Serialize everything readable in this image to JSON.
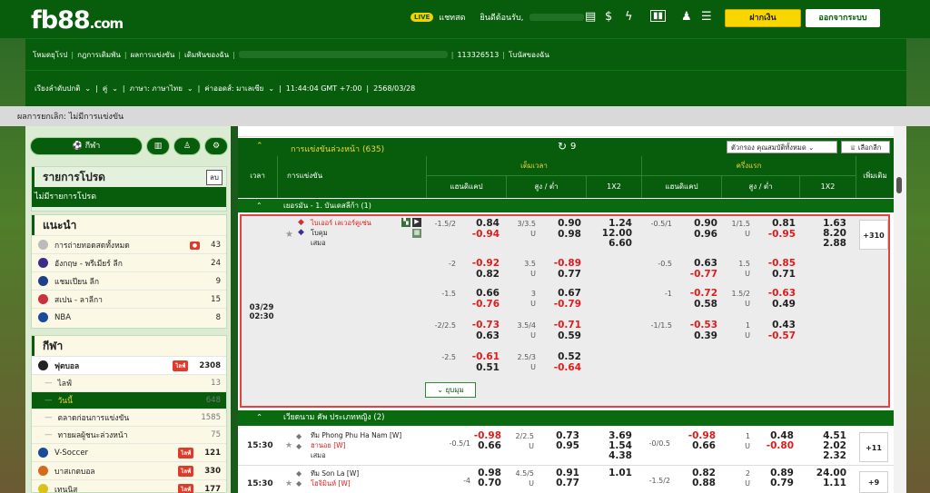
{
  "header": {
    "logo_main": "fb88",
    "logo_suffix": ".com",
    "chat_label": "แชทสด",
    "chat_badge": "LIVE",
    "welcome": "ยินดีต้อนรับ,",
    "deposit_label": "ฝากเงิน",
    "logout_label": "ออกจากระบบ"
  },
  "nav1": {
    "items": [
      "โหมดยุโรป",
      "กฎการเดิมพัน",
      "ผลการแข่งขัน",
      "เดิมพันของฉัน"
    ],
    "account_id": "113326513",
    "bonus_label": "โบนัสของฉัน"
  },
  "nav2": {
    "sort": "เรียงลำดับปกติ",
    "pair": "คู่",
    "lang": "ภาษา: ภาษาไทย",
    "odds": "ค่าออดส์: มาเลเซีย",
    "time": "11:44:04 GMT +7:00",
    "date": "2568/03/28"
  },
  "strip_text": "ผลการยกเลิก: ไม่มีการแข่งขัน",
  "left": {
    "sport_btn": "กีฬา",
    "fav_title": "รายการโปรด",
    "fav_toggle": "ลบ",
    "fav_empty": "ไม่มีรายการโปรด",
    "rec_title": "แนะนำ",
    "rec_items": [
      {
        "label": "การถ่ายทอดสดทั้งหมด",
        "count": "43",
        "live": true
      },
      {
        "label": "อังกฤษ - พรีเมียร์ ลีก",
        "count": "24"
      },
      {
        "label": "แชมเปียน ลีก",
        "count": "9"
      },
      {
        "label": "สเปน - ลาลีกา",
        "count": "15"
      },
      {
        "label": "NBA",
        "count": "8"
      }
    ],
    "sport_title": "กีฬา",
    "sport_items": [
      {
        "label": "ฟุตบอล",
        "count": "2308",
        "live": true,
        "sub": false
      },
      {
        "label": "ไลฟ์",
        "count": "13",
        "sub": true
      },
      {
        "label": "วันนี้",
        "count": "648",
        "sub": true,
        "active": true
      },
      {
        "label": "ตลาดก่อนการแข่งขัน",
        "count": "1585",
        "sub": true
      },
      {
        "label": "ทายผลผู้ชนะล่วงหน้า",
        "count": "75",
        "sub": true
      },
      {
        "label": "V-Soccer",
        "count": "121",
        "live": true
      },
      {
        "label": "บาสเกตบอล",
        "count": "330",
        "live": true
      },
      {
        "label": "เทนนิส",
        "count": "177",
        "live": true
      }
    ],
    "live_badge": "ไลฟ์"
  },
  "market": {
    "title": "การแข่งขันล่วงหน้า (635)",
    "refresh": "9",
    "filter": "ตัวกรอง คุณสมบัติทั้งหมด",
    "select": "เลือกลีก"
  },
  "cols": {
    "time": "เวลา",
    "match": "การแข่งขัน",
    "fulltime": "เต็มเวลา",
    "firsthalf": "ครึ่งแรก",
    "hdp": "แฮนดิแคป",
    "ou": "สูง / ต่ำ",
    "x12": "1X2",
    "more": "เพิ่มเติม"
  },
  "league1": "เยอรมัน - 1. บันเดสลีก้า (1)",
  "match1": {
    "date": "03/29",
    "time": "02:30",
    "home": "ไบเออร์ เลเวอร์คูเซ่น",
    "away": "โบคุม",
    "draw": "เสมอ",
    "more": "+310",
    "lines": [
      {
        "hdp": "-1.5/2",
        "h1": "0.84",
        "h2": "-0.94",
        "ou": "3/3.5",
        "o1": "0.90",
        "o2": "0.98",
        "x": [
          "1.24",
          "12.00",
          "6.60"
        ],
        "hhdp": "-0.5/1",
        "hh1": "0.90",
        "hh2": "0.96",
        "hou": "1/1.5",
        "ho1": "0.81",
        "ho2": "-0.95",
        "hx": [
          "1.63",
          "8.20",
          "2.88"
        ]
      },
      {
        "hdp": "-2",
        "h1": "-0.92",
        "h2": "0.82",
        "ou": "3.5",
        "o1": "-0.89",
        "o2": "0.77",
        "hhdp": "-0.5",
        "hh1": "0.63",
        "hh2": "-0.77",
        "hou": "1.5",
        "ho1": "-0.85",
        "ho2": "0.71"
      },
      {
        "hdp": "-1.5",
        "h1": "0.66",
        "h2": "-0.76",
        "ou": "3",
        "o1": "0.67",
        "o2": "-0.79",
        "hhdp": "-1",
        "hh1": "-0.72",
        "hh2": "0.58",
        "hou": "1.5/2",
        "ho1": "-0.63",
        "ho2": "0.49"
      },
      {
        "hdp": "-2/2.5",
        "h1": "-0.73",
        "h2": "0.63",
        "ou": "3.5/4",
        "o1": "-0.71",
        "o2": "0.59",
        "hhdp": "-1/1.5",
        "hh1": "-0.53",
        "hh2": "0.39",
        "hou": "1",
        "ho1": "0.43",
        "ho2": "-0.57"
      },
      {
        "hdp": "-2.5",
        "h1": "-0.61",
        "h2": "0.51",
        "ou": "2.5/3",
        "o1": "0.52",
        "o2": "-0.64"
      }
    ],
    "collapse": "ยุบมุม",
    "u": "U"
  },
  "league2": "เวียดนาม คัพ ประเภทหญิง (2)",
  "match2": {
    "time": "15:30",
    "home": "ทีม Phong Phu Ha Nam [W]",
    "away": "ฮานอย [W]",
    "draw": "เสมอ",
    "hdp": "-0.5/1",
    "h1": "-0.98",
    "h2": "0.66",
    "ou": "2/2.5",
    "o1": "0.73",
    "o2": "0.95",
    "x": [
      "3.69",
      "1.54",
      "4.38"
    ],
    "hhdp": "-0/0.5",
    "hh1": "-0.98",
    "hh2": "0.66",
    "hou": "1",
    "ho1": "0.48",
    "ho2": "-0.80",
    "hx": [
      "4.51",
      "2.02",
      "2.32"
    ],
    "more": "+11"
  },
  "match3": {
    "time": "15:30",
    "home": "ทีม Son La [W]",
    "away": "โฮจิมินห์ [W]",
    "hdp": "-4",
    "h1": "0.98",
    "h2": "0.70",
    "ou": "4.5/5",
    "o1": "0.91",
    "o2": "0.77",
    "x": [
      "1.01"
    ],
    "hhdp": "-1.5/2",
    "hh1": "0.82",
    "hh2": "0.88",
    "hou": "2",
    "ho1": "0.89",
    "ho2": "0.79",
    "hx": [
      "24.00",
      "1.11"
    ],
    "more": "+9"
  }
}
